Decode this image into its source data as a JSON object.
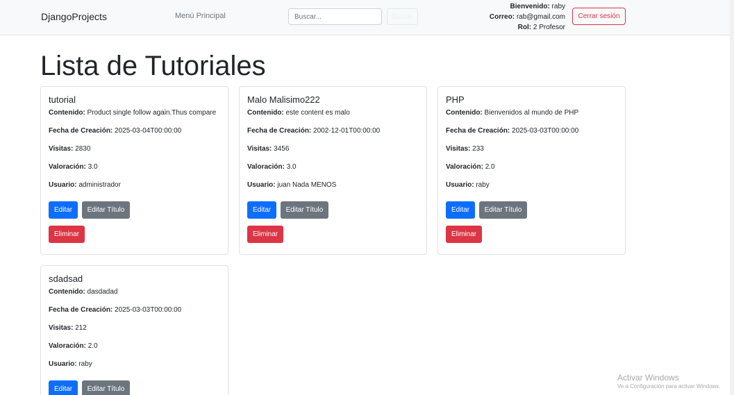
{
  "navbar": {
    "brand": "DjangoProjects",
    "menu_link": "Menú Principal",
    "search_placeholder": "Buscar...",
    "search_button": "Buscar",
    "user": {
      "welcome_label": "Bienvenido:",
      "welcome_value": "raby",
      "email_label": "Correo:",
      "email_value": "rab@gmail.com",
      "role_label": "Rol:",
      "role_value": "2 Profesor"
    },
    "logout_button": "Cerrar sesión"
  },
  "page": {
    "title": "Lista de Tutoriales"
  },
  "labels": {
    "content": "Contenido:",
    "created": "Fecha de Creación:",
    "visits": "Visitas:",
    "rating": "Valoración:",
    "user": "Usuario:"
  },
  "buttons": {
    "edit": "Editar",
    "edit_title": "Editar Título",
    "delete": "Eliminar"
  },
  "tutorials": [
    {
      "title": "tutorial",
      "content": "Product single follow again.Thus compare",
      "created": "2025-03-04T00:00:00",
      "visits": "2830",
      "rating": "3.0",
      "user": "administrador"
    },
    {
      "title": "Malo Malisimo222",
      "content": "este content es malo",
      "created": "2002-12-01T00:00:00",
      "visits": "3456",
      "rating": "3.0",
      "user": "juan Nada MENOS"
    },
    {
      "title": "PHP",
      "content": "Bienvenidos al mundo de PHP",
      "created": "2025-03-03T00:00:00",
      "visits": "233",
      "rating": "2.0",
      "user": "raby"
    },
    {
      "title": "sdadsad",
      "content": "dasdadad",
      "created": "2025-03-03T00:00:00",
      "visits": "212",
      "rating": "2.0",
      "user": "raby"
    }
  ],
  "watermark": {
    "line1": "Activar Windows",
    "line2": "Ve a Configuración para activar Windows."
  }
}
